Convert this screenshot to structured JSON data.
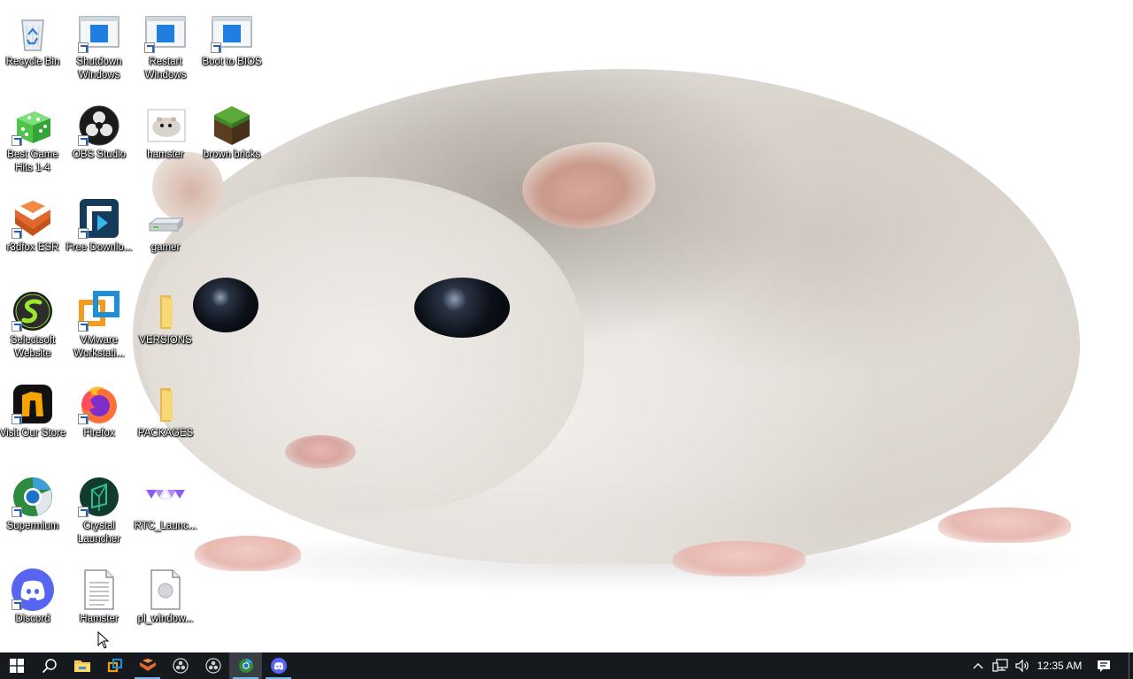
{
  "desktop": {
    "icons": [
      {
        "id": "recycle-bin",
        "label": "Recycle Bin",
        "shortcut": false
      },
      {
        "id": "shutdown-windows",
        "label": "Shutdown Windows",
        "shortcut": true
      },
      {
        "id": "restart-windows",
        "label": "Restart Windows",
        "shortcut": true
      },
      {
        "id": "boot-to-bios",
        "label": "Boot to BIOS",
        "shortcut": true
      },
      {
        "id": "best-game-hits",
        "label": "Best Game Hits 1-4",
        "shortcut": true
      },
      {
        "id": "obs-studio",
        "label": "OBS Studio",
        "shortcut": true
      },
      {
        "id": "hamster-image",
        "label": "hamster",
        "shortcut": false
      },
      {
        "id": "brown-bricks",
        "label": "brown bricks",
        "shortcut": false
      },
      {
        "id": "r3dfox-esr",
        "label": "r3dfox ESR",
        "shortcut": true
      },
      {
        "id": "free-download",
        "label": "Free Downlo...",
        "shortcut": true
      },
      {
        "id": "gamer-drive",
        "label": "gamer",
        "shortcut": false
      },
      {
        "id": "selectsoft-website",
        "label": "Selectsoft Website",
        "shortcut": true
      },
      {
        "id": "vmware-workstation",
        "label": "VMware Workstati...",
        "shortcut": true
      },
      {
        "id": "versions-folder",
        "label": "VERSIONS",
        "shortcut": false
      },
      {
        "id": "visit-our-store",
        "label": "Visit Our Store",
        "shortcut": true
      },
      {
        "id": "firefox",
        "label": "Firefox",
        "shortcut": true
      },
      {
        "id": "packages-folder",
        "label": "PACKAGES",
        "shortcut": false
      },
      {
        "id": "supermium",
        "label": "Supermium",
        "shortcut": true
      },
      {
        "id": "crystal-launcher",
        "label": "Crystal Launcher",
        "shortcut": true
      },
      {
        "id": "rtc-launcher",
        "label": "RTC_Launc...",
        "shortcut": false
      },
      {
        "id": "discord",
        "label": "Discord",
        "shortcut": true
      },
      {
        "id": "hamster-text",
        "label": "Hamster",
        "shortcut": false
      },
      {
        "id": "pl-window",
        "label": "pl_window...",
        "shortcut": false
      }
    ]
  },
  "taskbar": {
    "items": [
      {
        "icon": "windows-start-icon"
      },
      {
        "icon": "search-icon"
      },
      {
        "icon": "file-explorer-icon"
      },
      {
        "icon": "vmware-icon"
      },
      {
        "icon": "r3dfox-icon"
      },
      {
        "icon": "obs-studio-icon"
      },
      {
        "icon": "obs-studio-icon"
      },
      {
        "icon": "supermium-icon"
      },
      {
        "icon": "discord-icon"
      }
    ],
    "tray": {
      "icons": [
        "chevron-up-icon",
        "network-icon",
        "speaker-icon"
      ],
      "time": "12:35 AM",
      "notification_icon": "action-center-icon"
    }
  },
  "colors": {
    "taskbar_bg": "#16191d",
    "accent": "#76b9ed",
    "discord": "#5865f2",
    "folder": "#f8d775"
  }
}
